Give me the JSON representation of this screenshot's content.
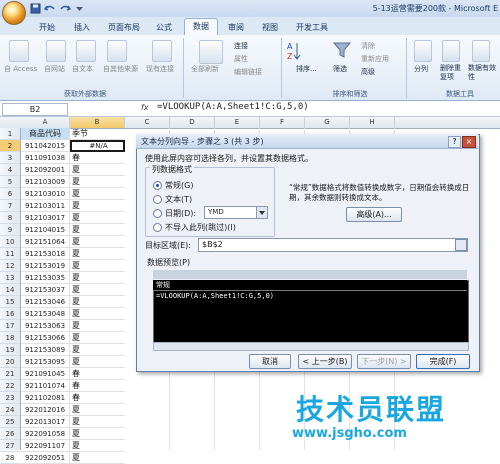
{
  "title_bar": {
    "title": "5-13运营需要200款 - Microsoft E"
  },
  "tabs": [
    "开始",
    "插入",
    "页面布局",
    "公式",
    "数据",
    "审阅",
    "视图",
    "开发工具"
  ],
  "active_tab": "数据",
  "ribbon": {
    "get_external": {
      "label": "获取外部数据",
      "buttons": [
        "自 Access",
        "自网站",
        "自文本",
        "自其他来源",
        "现有连接"
      ]
    },
    "connections": {
      "refresh_all": "全部刷新",
      "connection": "连接",
      "properties": "属性",
      "edit_links": "编辑链接"
    },
    "sort_filter": {
      "label": "排序和筛选",
      "sort": "排序...",
      "filter": "筛选",
      "clear": "清除",
      "reapply": "重新应用",
      "advanced": "高级"
    },
    "data_tools": {
      "label": "数据工具",
      "split": "分列",
      "remove_dup": "删除重复项",
      "validation": "数据有效性",
      "validation2": "效性"
    }
  },
  "formula_bar": {
    "name_box": "B2",
    "fx": "fx",
    "formula": "=VLOOKUP(A:A,Sheet1!C:G,5,0)"
  },
  "columns": [
    "A",
    "B",
    "C",
    "D",
    "E",
    "F",
    "G",
    "H"
  ],
  "header_row": {
    "a": "商品代码",
    "b": "季节"
  },
  "rows": [
    {
      "num": "1"
    },
    {
      "num": "2",
      "a": "911042015",
      "b": "#N/A"
    },
    {
      "num": "3",
      "a": "911091038",
      "b": "春"
    },
    {
      "num": "4",
      "a": "912092001",
      "b": "夏"
    },
    {
      "num": "5",
      "a": "912103009",
      "b": "夏"
    },
    {
      "num": "6",
      "a": "912103010",
      "b": "夏"
    },
    {
      "num": "7",
      "a": "912103011",
      "b": "夏"
    },
    {
      "num": "8",
      "a": "912103017",
      "b": "夏"
    },
    {
      "num": "9",
      "a": "912104015",
      "b": "夏"
    },
    {
      "num": "10",
      "a": "912151064",
      "b": "夏"
    },
    {
      "num": "11",
      "a": "912153018",
      "b": "夏"
    },
    {
      "num": "12",
      "a": "912153019",
      "b": "夏"
    },
    {
      "num": "13",
      "a": "912153035",
      "b": "夏"
    },
    {
      "num": "14",
      "a": "912153037",
      "b": "夏"
    },
    {
      "num": "15",
      "a": "912153046",
      "b": "夏"
    },
    {
      "num": "16",
      "a": "912153048",
      "b": "夏"
    },
    {
      "num": "17",
      "a": "912153063",
      "b": "夏"
    },
    {
      "num": "18",
      "a": "912153066",
      "b": "夏"
    },
    {
      "num": "19",
      "a": "912153089",
      "b": "夏"
    },
    {
      "num": "20",
      "a": "912153095",
      "b": "夏"
    },
    {
      "num": "21",
      "a": "921091045",
      "b": "春"
    },
    {
      "num": "22",
      "a": "921101074",
      "b": "春"
    },
    {
      "num": "23",
      "a": "921102081",
      "b": "春"
    },
    {
      "num": "24",
      "a": "922012016",
      "b": "夏"
    },
    {
      "num": "25",
      "a": "922013017",
      "b": "夏"
    },
    {
      "num": "26",
      "a": "922091058",
      "b": "夏"
    },
    {
      "num": "27",
      "a": "922091107",
      "b": "夏"
    },
    {
      "num": "28",
      "a": "922092051",
      "b": "夏"
    }
  ],
  "dialog": {
    "title": "文本分列向导 - 步骤之 3 (共 3 步)",
    "help": "?",
    "close": "×",
    "intro": "使用此屏内容可选择各列，并设置其数据格式。",
    "format_group": "列数据格式",
    "opt_general": "常规(G)",
    "opt_text": "文本(T)",
    "opt_date": "日期(D):",
    "date_value": "YMD",
    "opt_skip": "不导入此列(跳过)(I)",
    "note": "“常规”数据格式将数值转换成数字，日期值会转换成日期，其余数据则转换成文本。",
    "advanced": "高级(A)...",
    "target_label": "目标区域(E):",
    "target_value": "$B$2",
    "preview_label": "数据预览(P)",
    "preview_header": "常规",
    "preview_content": "=VLOOKUP(A:A,Sheet1!C:G,5,0)",
    "btn_cancel": "取消",
    "btn_back": "< 上一步(B)",
    "btn_next": "下一步(N) >",
    "btn_finish": "完成(F)"
  },
  "watermark": {
    "main": "技术员联盟",
    "url": "www.jsgho.com"
  }
}
